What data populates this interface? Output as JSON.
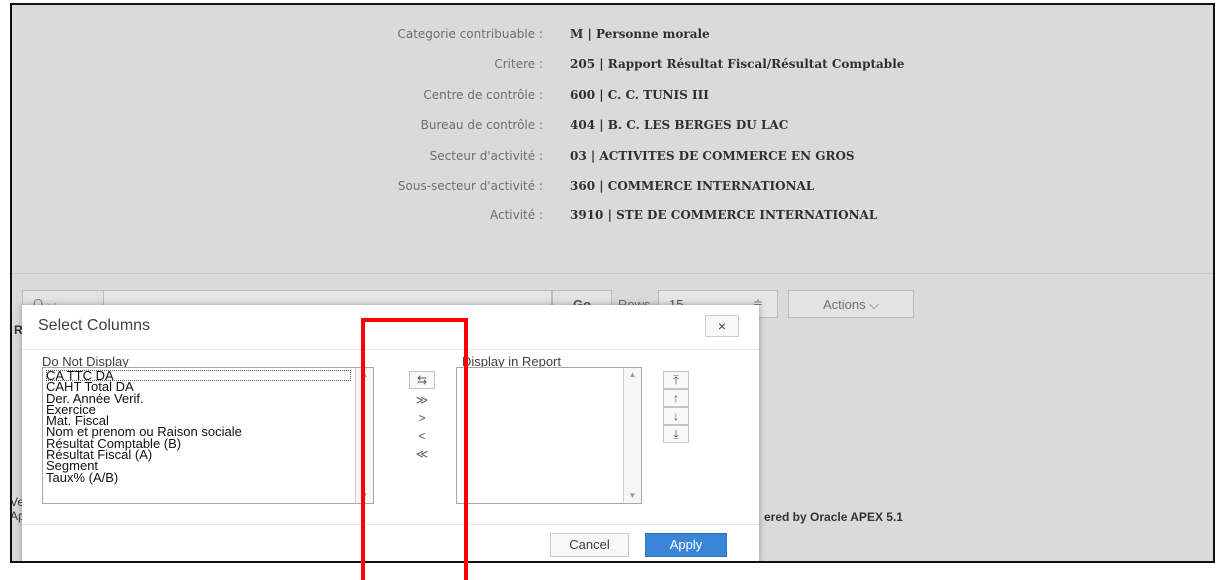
{
  "info": [
    {
      "label": "Categorie contribuable :",
      "value": "M | Personne morale"
    },
    {
      "label": "Critere :",
      "value": "205 | Rapport Résultat Fiscal/Résultat Comptable"
    },
    {
      "label": "Centre de contrôle :",
      "value": "600 | C. C. TUNIS III"
    },
    {
      "label": "Bureau de contrôle :",
      "value": "404 | B. C. LES BERGES DU LAC"
    },
    {
      "label": "Secteur d'activité :",
      "value": "03 | ACTIVITES DE COMMERCE EN GROS"
    },
    {
      "label": "Sous-secteur d'activité :",
      "value": "360 | COMMERCE INTERNATIONAL"
    },
    {
      "label": "Activité :",
      "value": "3910 | STE DE COMMERCE INTERNATIONAL"
    }
  ],
  "toolbar": {
    "search_icon": "Q ⌵",
    "go_label": "Go",
    "rows_label": "Rows",
    "rows_value": "15",
    "rows_arrow": "≑",
    "actions_label": "Actions ⌵"
  },
  "background_fragments": {
    "re": "Re",
    "ve": "Ve",
    "ap": "Ap",
    "footer": "ered by Oracle APEX 5.1"
  },
  "dialog": {
    "title": "Select Columns",
    "close_icon": "×",
    "do_not_display_label": "Do Not Display",
    "display_in_report_label": "Display in Report",
    "do_not_display_items": [
      "CA TTC DA",
      "CAHT Total DA",
      "Der. Année Verif.",
      "Exercice",
      "Mat. Fiscal",
      "Nom et prenom ou Raison sociale",
      "Résultat Comptable (B)",
      "Résultat Fiscal (A)",
      "Segment",
      "Taux% (A/B)"
    ],
    "move_buttons": [
      "⇆",
      "≫",
      ">",
      "<",
      "≪"
    ],
    "order_buttons": [
      "⤒",
      "↑",
      "↓",
      "⤓"
    ],
    "cancel_label": "Cancel",
    "apply_label": "Apply"
  },
  "colors": {
    "accent": "#3a85d6",
    "highlight_box": "#ff0000",
    "overlay": "#dadada"
  }
}
